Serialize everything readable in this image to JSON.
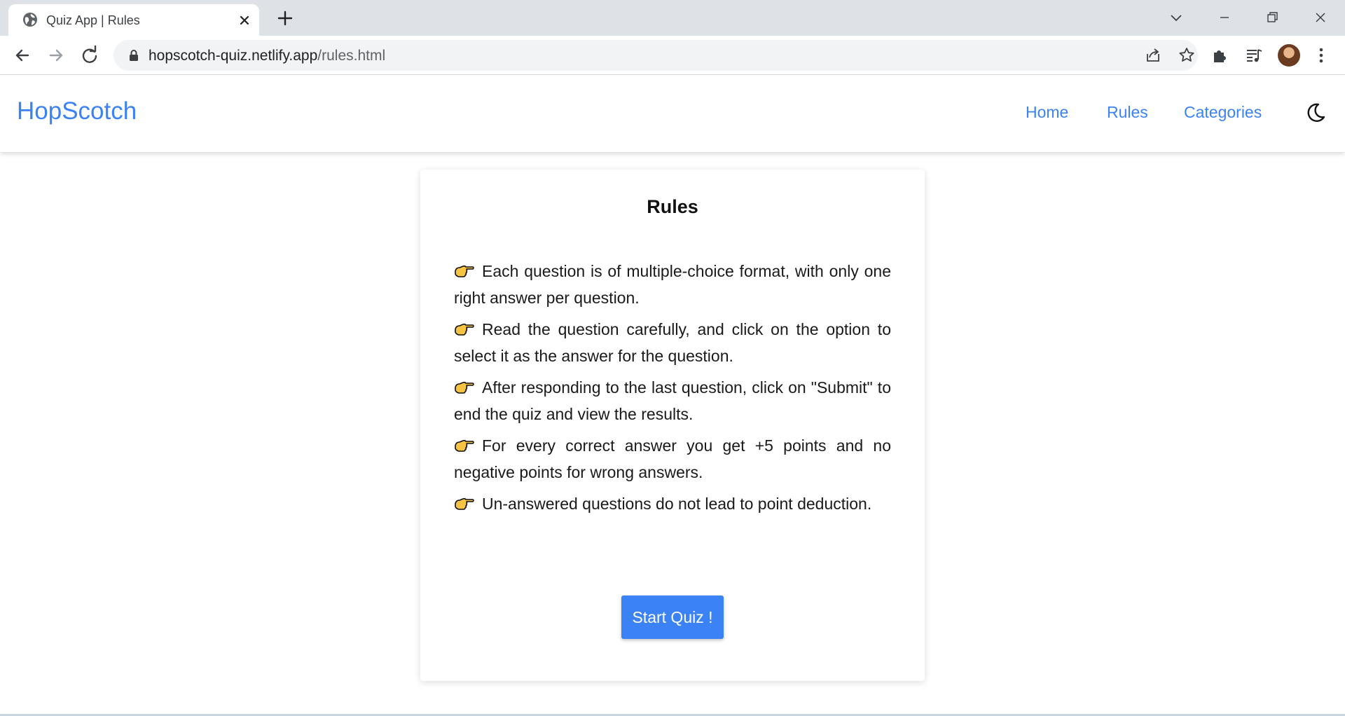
{
  "browser": {
    "tab_title": "Quiz App | Rules",
    "url_host": "hopscotch-quiz.netlify.app",
    "url_path": "/rules.html"
  },
  "navbar": {
    "brand": "HopScotch",
    "links": [
      "Home",
      "Rules",
      "Categories"
    ]
  },
  "rules_card": {
    "title": "Rules",
    "items": [
      "Each question is of multiple-choice format, with only one right answer per question.",
      "Read the question carefully, and click on the option to select it as the answer for the question.",
      "After responding to the last question, click on \"Submit\" to end the quiz and view the results.",
      "For every correct answer you get +5 points and no negative points for wrong answers.",
      "Un-answered questions do not lead to point deduction."
    ],
    "start_button": "Start Quiz !"
  },
  "colors": {
    "accent": "#3b82f6",
    "tabstrip": "#dee1e6",
    "pointer_fill": "#f6c343"
  },
  "icons": {
    "rule_bullet": "pointing-hand-icon",
    "theme_toggle": "moon-icon"
  }
}
